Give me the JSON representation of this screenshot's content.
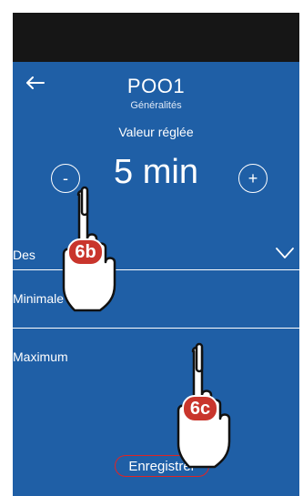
{
  "header": {
    "title": "POO1",
    "subtitle": "Généralités"
  },
  "setting": {
    "label": "Valeur réglée",
    "value": "5 min",
    "minus_label": "-",
    "plus_label": "+"
  },
  "fields": {
    "description_label": "Des",
    "minimum_label": "Minimale",
    "maximum_label": "Maximum"
  },
  "actions": {
    "save_label": "Enregistrer"
  },
  "annotations": {
    "hand_b_tag": "6b",
    "hand_c_tag": "6c"
  },
  "colors": {
    "background": "#1f5fa6",
    "top_bar": "#161616",
    "highlight": "#e02424"
  },
  "icons": {
    "back": "back-arrow-icon",
    "dropdown": "chevron-down-icon"
  }
}
